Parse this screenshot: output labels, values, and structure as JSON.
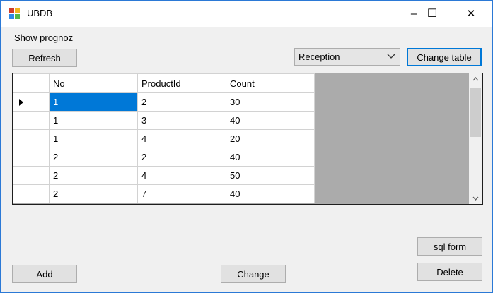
{
  "window": {
    "title": "UBDB",
    "minimize": "–",
    "maximize": "☐",
    "close": "✕"
  },
  "form": {
    "label": "Show prognoz"
  },
  "toolbar": {
    "refresh_label": "Refresh",
    "change_table_label": "Change table"
  },
  "table_select": {
    "value": "Reception"
  },
  "grid": {
    "columns": [
      "No",
      "ProductId",
      "Count"
    ],
    "rows": [
      [
        "1",
        "2",
        "30"
      ],
      [
        "1",
        "3",
        "40"
      ],
      [
        "1",
        "4",
        "20"
      ],
      [
        "2",
        "2",
        "40"
      ],
      [
        "2",
        "4",
        "50"
      ],
      [
        "2",
        "7",
        "40"
      ]
    ]
  },
  "actions": {
    "add_label": "Add",
    "change_label": "Change",
    "sql_form_label": "sql form",
    "delete_label": "Delete"
  },
  "colors": {
    "accent": "#0078d7",
    "selected_cell": "#0078d7",
    "grid_bg": "#ababab",
    "window_border": "#2b79d6"
  }
}
